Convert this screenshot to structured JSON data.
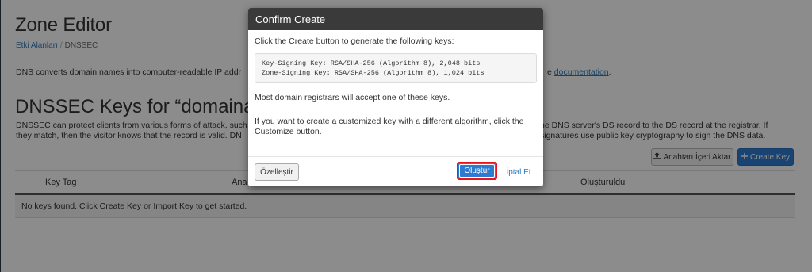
{
  "page": {
    "title": "Zone Editor",
    "breadcrumb": {
      "parent": "Etki Alanları",
      "separator": "/",
      "current": "DNSSEC"
    },
    "intro_left": "DNS converts domain names into computer-readable IP addr",
    "intro_right": "e ",
    "intro_link": "documentation",
    "intro_end": ".",
    "section_title": "DNSSEC Keys for “domainadı",
    "desc_line1_left": "DNSSEC can protect clients from various forms of attack, such",
    "desc_line1_right": "he DNS server's DS record to the DS record at the registrar. If",
    "desc_line2_left": "they match, then the visitor knows that the record is valid. DN",
    "desc_line2_right": "signatures use public key cryptography to sign the DNS data.",
    "import_button": "Anahtarı İçeri Aktar",
    "create_key_button": "Create Key",
    "table": {
      "headers": [
        "Key Tag",
        "Ana",
        "Oluşturuldu"
      ],
      "empty_message": "No keys found. Click Create Key or Import Key to get started."
    }
  },
  "modal": {
    "title": "Confirm Create",
    "intro": "Click the Create button to generate the following keys:",
    "keys": [
      "Key-Signing Key: RSA/SHA-256 (Algorithm 8), 2,048 bits",
      "Zone-Signing Key: RSA/SHA-256 (Algorithm 8), 1,024 bits"
    ],
    "note": "Most domain registrars will accept one of these keys.",
    "customize_note": "If you want to create a customized key with a different algorithm, click the Customize button.",
    "customize_button": "Özelleştir",
    "create_button": "Oluştur",
    "cancel_button": "İptal Et"
  },
  "colors": {
    "primary": "#2d7bd0",
    "highlight": "#e8131c",
    "modal_header": "#3a3a3a"
  },
  "icons": {
    "import": "upload-icon",
    "create": "plus-icon"
  }
}
